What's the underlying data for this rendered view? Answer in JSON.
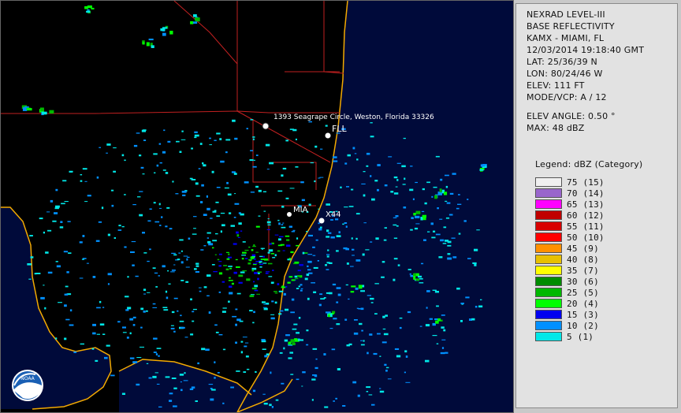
{
  "map": {
    "pins": [
      {
        "label": "1393 Seagrape Circle, Weston, Florida 33326"
      },
      {
        "label": "FLL"
      },
      {
        "label": "MIA"
      },
      {
        "label": "X44"
      }
    ],
    "logo_text": "NOAA"
  },
  "info": {
    "product": "NEXRAD LEVEL-III",
    "type": "BASE REFLECTIVITY",
    "station": "KAMX - MIAMI, FL",
    "datetime": "12/03/2014 19:18:40 GMT",
    "lat": "LAT: 25/36/39 N",
    "lon": "LON: 80/24/46 W",
    "elev": "ELEV: 111 FT",
    "mode": "MODE/VCP: A / 12",
    "elev_angle": "ELEV ANGLE: 0.50 °",
    "max": "MAX: 48 dBZ"
  },
  "legend": {
    "title": "Legend: dBZ (Category)",
    "items": [
      {
        "value": "75 (15)",
        "color": "#f0f0f0"
      },
      {
        "value": "70 (14)",
        "color": "#9966cc"
      },
      {
        "value": "65 (13)",
        "color": "#ff00ff"
      },
      {
        "value": "60 (12)",
        "color": "#c00000"
      },
      {
        "value": "55 (11)",
        "color": "#d80000"
      },
      {
        "value": "50 (10)",
        "color": "#ff0000"
      },
      {
        "value": "45 (9)",
        "color": "#ff9000"
      },
      {
        "value": "40 (8)",
        "color": "#e8c000"
      },
      {
        "value": "35 (7)",
        "color": "#ffff00"
      },
      {
        "value": "30 (6)",
        "color": "#008c00"
      },
      {
        "value": "25 (5)",
        "color": "#00b800"
      },
      {
        "value": "20 (4)",
        "color": "#00ff00"
      },
      {
        "value": "15 (3)",
        "color": "#0000f0"
      },
      {
        "value": "10 (2)",
        "color": "#0090ff"
      },
      {
        "value": "5 (1)",
        "color": "#00e8e8"
      }
    ]
  }
}
